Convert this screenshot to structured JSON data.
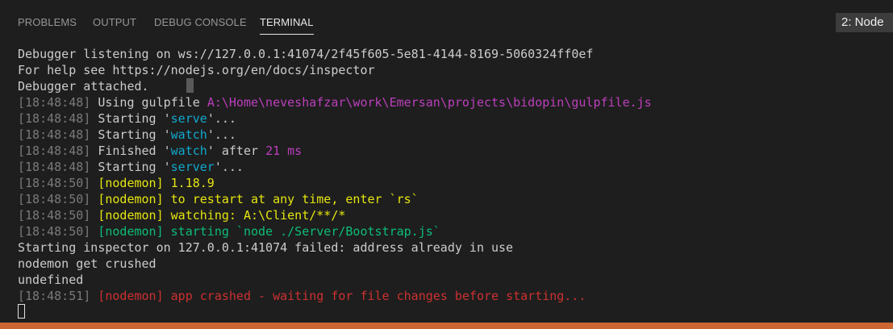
{
  "panel": {
    "tabs": [
      {
        "label": "PROBLEMS"
      },
      {
        "label": "OUTPUT"
      },
      {
        "label": "DEBUG CONSOLE"
      },
      {
        "label": "TERMINAL"
      }
    ],
    "terminal_select": "2: Node"
  },
  "terminal": {
    "lines": [
      {
        "text": "Debugger listening on ws://127.0.0.1:41074/2f45f605-5e81-4144-8169-5060324ff0ef"
      },
      {
        "text": "For help see https://nodejs.org/en/docs/inspector"
      },
      {
        "text": "Debugger attached."
      },
      {
        "ts": "[18:48:48]",
        "parts": [
          " Using gulpfile ",
          "A:\\Home\\neveshafzar\\work\\Emersan\\projects\\bidopin\\gulpfile.js"
        ]
      },
      {
        "ts": "[18:48:48]",
        "parts": [
          " Starting '",
          "serve",
          "'..."
        ]
      },
      {
        "ts": "[18:48:48]",
        "parts": [
          " Starting '",
          "watch",
          "'..."
        ]
      },
      {
        "ts": "[18:48:48]",
        "parts": [
          " Finished '",
          "watch",
          "' after ",
          "21 ms"
        ]
      },
      {
        "ts": "[18:48:48]",
        "parts": [
          " Starting '",
          "server",
          "'..."
        ]
      },
      {
        "ts": "[18:48:50]",
        "parts": [
          " [nodemon] 1.18.9"
        ]
      },
      {
        "ts": "[18:48:50]",
        "parts": [
          " [nodemon] to restart at any time, enter `rs`"
        ]
      },
      {
        "ts": "[18:48:50]",
        "parts": [
          " [nodemon] watching: A:\\Client/**/*"
        ]
      },
      {
        "ts": "[18:48:50]",
        "parts": [
          " [nodemon] starting `node ./Server/Bootstrap.js`"
        ]
      },
      {
        "text": "Starting inspector on 127.0.0.1:41074 failed: address already in use"
      },
      {
        "text": "nodemon get crushed"
      },
      {
        "text": "undefined"
      },
      {
        "ts": "[18:48:51]",
        "parts": [
          " [nodemon] app crashed - waiting for file changes before starting..."
        ]
      }
    ]
  },
  "colors": {
    "background": "#1e1e1e",
    "timestamp": "#7a7a7a",
    "path": "#bc3fbc",
    "task": "#11a8cd",
    "nodemon_info": "#e5e510",
    "nodemon_start": "#0dbc79",
    "nodemon_error": "#cd3131",
    "status_bar": "#cc6633"
  }
}
